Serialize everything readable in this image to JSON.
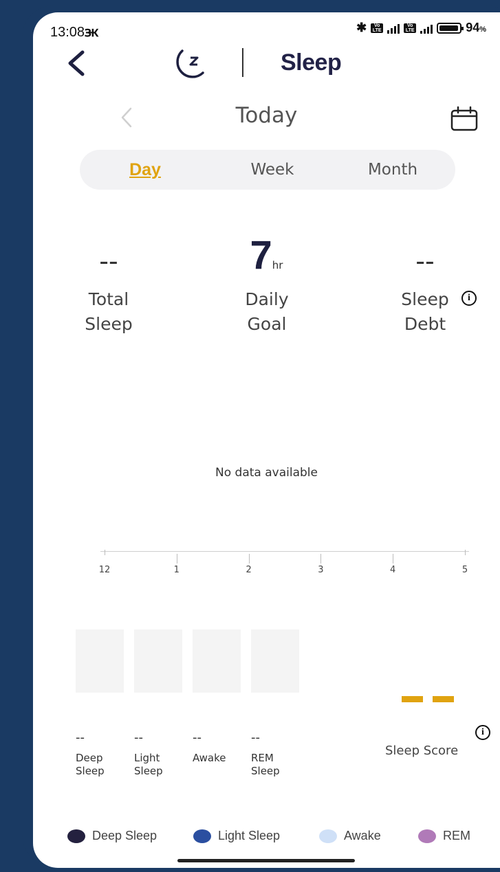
{
  "status": {
    "time": "13:08",
    "carrier_glyph": "ꚅ",
    "battery_pct": "94",
    "battery_unit": "%"
  },
  "header": {
    "title": "Sleep"
  },
  "date_nav": {
    "label": "Today"
  },
  "tabs": {
    "day": "Day",
    "week": "Week",
    "month": "Month",
    "active": "Day"
  },
  "stats": {
    "total": {
      "value": "--",
      "label_line1": "Total",
      "label_line2": "Sleep"
    },
    "goal": {
      "value": "7",
      "unit": "hr",
      "label_line1": "Daily",
      "label_line2": "Goal"
    },
    "debt": {
      "value": "--",
      "label_line1": "Sleep",
      "label_line2": "Debt"
    }
  },
  "chart_data": {
    "type": "bar",
    "message": "No data available",
    "x_ticks": [
      "12",
      "1",
      "2",
      "3",
      "4",
      "5"
    ],
    "series": []
  },
  "stages": [
    {
      "value": "--",
      "label_line1": "Deep",
      "label_line2": "Sleep"
    },
    {
      "value": "--",
      "label_line1": "Light",
      "label_line2": "Sleep"
    },
    {
      "value": "--",
      "label_line1": "Awake",
      "label_line2": ""
    },
    {
      "value": "--",
      "label_line1": "REM",
      "label_line2": "Sleep"
    }
  ],
  "score": {
    "label": "Sleep Score"
  },
  "legend": [
    {
      "label": "Deep Sleep",
      "color": "#24213f"
    },
    {
      "label": "Light Sleep",
      "color": "#2b4fa0"
    },
    {
      "label": "Awake",
      "color": "#cfe0f7"
    },
    {
      "label": "REM",
      "color": "#b07ab8"
    }
  ],
  "colors": {
    "accent": "#e0a310",
    "frame": "#1a3a63"
  }
}
